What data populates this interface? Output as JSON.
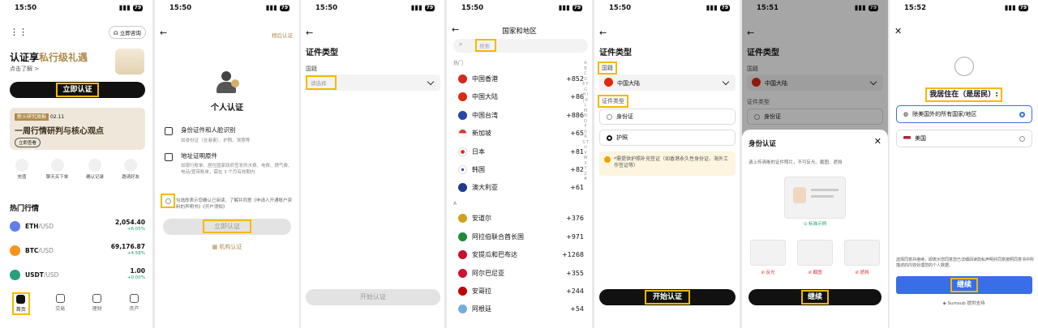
{
  "status": {
    "time": "15:50",
    "time2": "15:51",
    "time3": "15:52",
    "battery": "79"
  },
  "p1": {
    "consult": "立即咨询",
    "title_a": "认证享",
    "title_b": "私行级礼遇",
    "learn_more": "点击了解 >",
    "verify_btn": "立即认证",
    "banner_tag": "新火研究周报",
    "banner_date": "02.11",
    "banner_title": "一周行情研判与核心观点",
    "banner_btn": "立即查看",
    "shortcuts": [
      "充值",
      "聊天买下单",
      "确认记录",
      "邀请好友"
    ],
    "hot_title": "热门行情",
    "markets": [
      {
        "sym": "ETH",
        "quote": "/USD",
        "price": "2,054.40",
        "chg": "+6.05%",
        "color": "#627eea"
      },
      {
        "sym": "BTC",
        "quote": "/USD",
        "price": "69,176.87",
        "chg": "+4.58%",
        "color": "#f7931a"
      },
      {
        "sym": "USDT",
        "quote": "/USD",
        "price": "1.00",
        "chg": "+0.00%",
        "color": "#26a17b"
      }
    ],
    "nav": [
      "首页",
      "交易",
      "理财",
      "资产"
    ]
  },
  "p2": {
    "skip": "稍后认证",
    "title": "个人认证",
    "item1_title": "身份证件和人脸识别",
    "item1_desc": "如身份证（含港澳）、护照、驾照等",
    "item2_title": "地址证明原件",
    "item2_desc": "如银行账单、居住国家政府签发的水费、电费、燃气费、电话/宽带账单，需在 3 个月有效期内",
    "agree": "勾选即表示您确认已阅读、了解并同意《申请人开通账户资料的声明书》《开户须知》",
    "btn": "立即认证",
    "org": "机构认证"
  },
  "p3": {
    "title": "证件类型",
    "country_label": "国籍",
    "select_placeholder": "请选择",
    "btn": "开始认证"
  },
  "p4": {
    "title": "国家和地区",
    "search_placeholder": "搜索",
    "hot_label": "热门",
    "a_label": "A",
    "alphabet": "A B C D E F G H I J K L M N O P Q R S T U V W X Y Z #",
    "hot": [
      {
        "name": "中国香港",
        "code": "+852",
        "color": "#d52b1e"
      },
      {
        "name": "中国大陆",
        "code": "+86",
        "color": "#de2910"
      },
      {
        "name": "中国台湾",
        "code": "+886",
        "color": "#2a44a8"
      },
      {
        "name": "新加坡",
        "code": "+65",
        "color": "#e03030"
      },
      {
        "name": "日本",
        "code": "+81",
        "color": "#e0e0e0"
      },
      {
        "name": "韩国",
        "code": "+82",
        "color": "#3a5aa8"
      },
      {
        "name": "澳大利亚",
        "code": "+61",
        "color": "#1f3b8c"
      }
    ],
    "a_list": [
      {
        "name": "安道尔",
        "code": "+376",
        "color": "#d0a020"
      },
      {
        "name": "阿拉伯联合酋长国",
        "code": "+971",
        "color": "#1f8a3a"
      },
      {
        "name": "安提瓜和巴布达",
        "code": "+1268",
        "color": "#c8102e"
      },
      {
        "name": "阿尔巴尼亚",
        "code": "+355",
        "color": "#d0102e"
      },
      {
        "name": "安哥拉",
        "code": "+244",
        "color": "#c00000"
      },
      {
        "name": "阿根廷",
        "code": "+54",
        "color": "#74acdf"
      }
    ]
  },
  "p5": {
    "title": "证件类型",
    "country_label": "国籍",
    "country": "中国大陆",
    "type_label": "证件类型",
    "opt1": "身份证",
    "opt2": "护照",
    "notice": "*需提供护照补充签证（如香港永久性身份证、海外工作签证等）",
    "btn": "开始认证"
  },
  "p6": {
    "title": "证件类型",
    "country_label": "国籍",
    "country": "中国大陆",
    "type_label": "证件类型",
    "opt1": "身份证",
    "sheet_title": "身份认证",
    "sheet_desc": "请上传清晰的证件照片，不可反光、截图、遮挡",
    "sample": "标准示例",
    "bad": [
      "反光",
      "截图",
      "遮挡"
    ],
    "btn": "继续"
  },
  "p7": {
    "question": "我居住在（是居民）:",
    "opt1": "除美国外的所有国家/地区",
    "opt2": "美国",
    "terms": "选择同意并继续，即表示您同意您已详细阅读隐私声明并同意按照同意书中所描述的内容处理您的个人数据。",
    "btn": "继续",
    "powered": "Sumsub 提供支持"
  }
}
